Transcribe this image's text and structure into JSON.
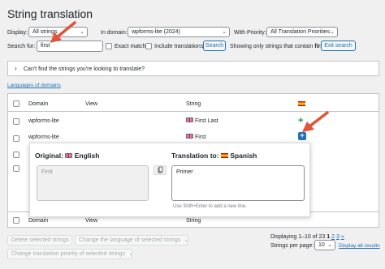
{
  "page_title": "String translation",
  "filters": {
    "display_label": "Display:",
    "display_value": "All strings",
    "domain_label": "In domain:",
    "domain_value": "wpforms-lite (2024)",
    "priority_label": "With Priority:",
    "priority_value": "All Translation Priorities",
    "search_label": "Search for:",
    "search_value": "first",
    "exact_match_label": "Exact match",
    "include_translations_label": "Include translations",
    "search_button": "Search",
    "showing_text": "Showing only strings that contain",
    "showing_term": "first",
    "exit_search_button": "Exit search"
  },
  "notice": {
    "chevron": "›",
    "text": "Can't find the strings you're looking to translate?"
  },
  "languages_link": "Languages of domains",
  "table": {
    "columns": {
      "domain": "Domain",
      "view": "View",
      "string": "String"
    },
    "rows": [
      {
        "domain": "wpforms-lite",
        "view": "",
        "string": "First Last"
      },
      {
        "domain": "wpforms-lite",
        "view": "",
        "string": "First"
      }
    ],
    "footer_columns": {
      "domain": "Domain",
      "view": "View",
      "string": "String"
    }
  },
  "editor": {
    "original_label": "Original:",
    "original_language": "English",
    "original_text": "First",
    "translation_label": "Translation to:",
    "translation_language": "Spanish",
    "translation_text": "Primer",
    "hint": "Use Shift+Enter to add a new line.",
    "copy_icon": "copy-icon"
  },
  "pagination": {
    "text": "Displaying 1–10 of 23",
    "pages": [
      "1",
      "2",
      "3",
      "»"
    ],
    "per_page_label": "Strings per page:",
    "per_page_value": "10",
    "display_all": "Display all results"
  },
  "bulk": {
    "delete": "Delete selected strings",
    "change_language": "Change the language of selected strings",
    "change_priority": "Change translation priority of selected strings"
  },
  "colors": {
    "accent": "#2271b1",
    "add_green": "#00a32a",
    "arrow_red": "#e2533a"
  }
}
